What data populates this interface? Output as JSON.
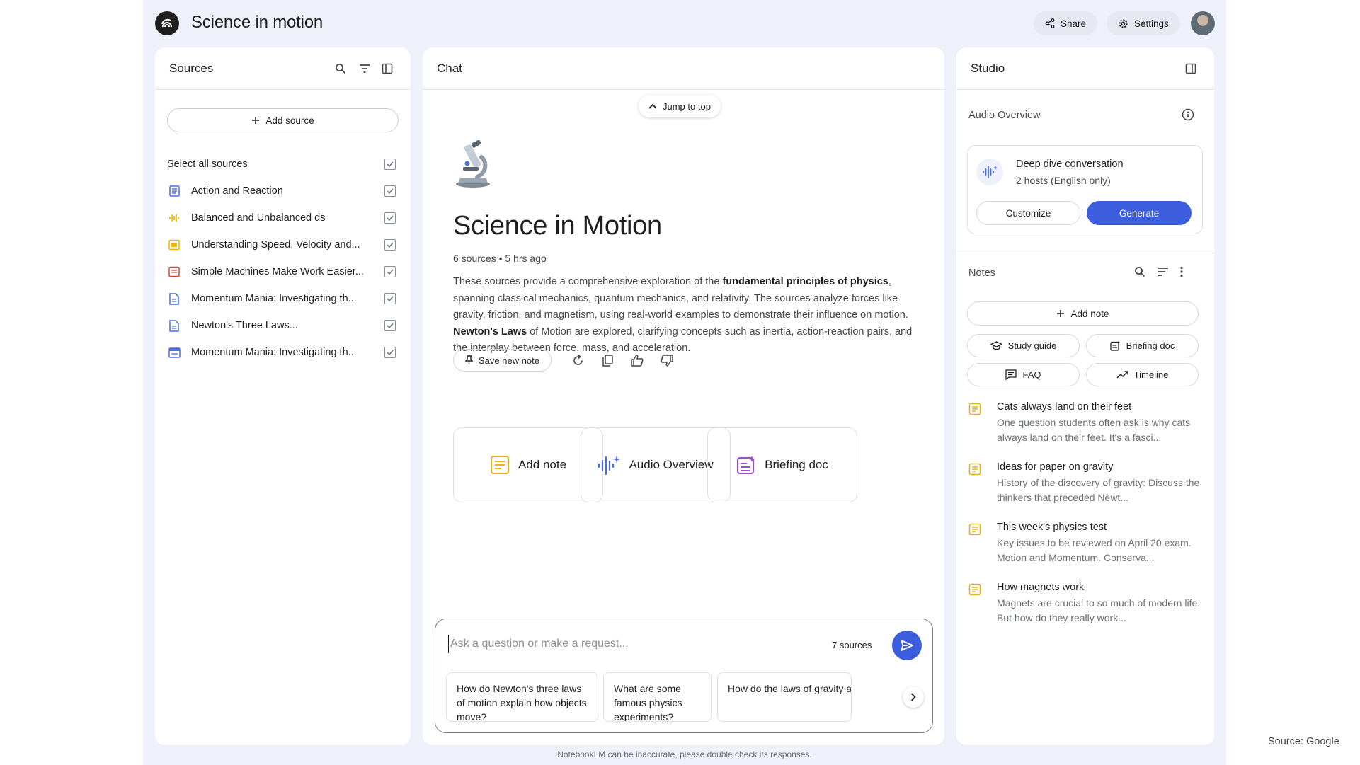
{
  "app": {
    "title": "Science in motion",
    "share_label": "Share",
    "settings_label": "Settings",
    "logo_icon": "notebooklm-logo-icon",
    "disclaimer": "NotebookLM can be inaccurate, please double check its responses."
  },
  "sources": {
    "title": "Sources",
    "add_label": "Add source",
    "select_all_label": "Select all sources",
    "items": [
      {
        "label": "Action and Reaction",
        "icon": "doc-icon",
        "color": "#4a6ee0"
      },
      {
        "label": "Balanced and Unbalanced ds",
        "icon": "audio-icon",
        "color": "#f2b400"
      },
      {
        "label": "Understanding Speed, Velocity and...",
        "icon": "slides-icon",
        "color": "#f2b400"
      },
      {
        "label": "Simple Machines Make Work Easier...",
        "icon": "pdf-icon",
        "color": "#d9443b"
      },
      {
        "label": "Momentum Mania: Investigating th...",
        "icon": "doc-icon",
        "color": "#4a6ee0"
      },
      {
        "label": "Newton's Three Laws...",
        "icon": "doc-icon",
        "color": "#4a6ee0"
      },
      {
        "label": "Momentum Mania: Investigating th...",
        "icon": "web-icon",
        "color": "#4a6ee0"
      }
    ]
  },
  "chat": {
    "title": "Chat",
    "jump_label": "Jump to top",
    "heading": "Science in Motion",
    "meta": "6 sources • 5 hrs ago",
    "summary": {
      "p1": "These sources provide a comprehensive exploration of the ",
      "b1": "fundamental principles of physics",
      "p2": ", spanning classical mechanics, quantum mechanics, and relativity. The sources analyze forces like gravity, friction, and magnetism, using real-world examples to demonstrate their influence on motion. ",
      "b2": "Newton's Laws",
      "p3": " of Motion are explored, clarifying concepts such as inertia, action-reaction pairs, and the interplay between force, mass, and acceleration."
    },
    "save_note_label": "Save new note",
    "cards": [
      {
        "label": "Add note"
      },
      {
        "label": "Audio Overview"
      },
      {
        "label": "Briefing doc"
      }
    ],
    "input_placeholder": "Ask a question or make a request...",
    "sources_count": "7 sources",
    "suggestions": [
      "How do Newton's three laws of motion explain how objects move?",
      "What are some famous physics experiments?",
      "How do the laws of gravity apply at very high speeds or distances?"
    ]
  },
  "studio": {
    "title": "Studio",
    "audio_overview_label": "Audio Overview",
    "audio_card": {
      "title": "Deep dive conversation",
      "subtitle": "2 hosts (English only)",
      "customize_label": "Customize",
      "generate_label": "Generate"
    },
    "notes_label": "Notes",
    "add_note_label": "Add note",
    "chips": [
      "Study guide",
      "Briefing doc",
      "FAQ",
      "Timeline"
    ],
    "notes": [
      {
        "title": "Cats always land on their feet",
        "body": "One question students often ask is why cats always land on their feet. It's a fasci..."
      },
      {
        "title": "Ideas for paper on gravity",
        "body": "History of the discovery of gravity: Discuss the thinkers that preceded Newt..."
      },
      {
        "title": "This week's physics test",
        "body": "Key issues to be reviewed on April 20 exam. Motion and Momentum. Conserva..."
      },
      {
        "title": "How magnets work",
        "body": "Magnets are crucial to so much of modern life. But how do they really work..."
      }
    ]
  },
  "credit": "Source: Google",
  "colors": {
    "background": "#eef1f9",
    "accent": "#3c5ede",
    "note_icon": "#e6b422"
  }
}
